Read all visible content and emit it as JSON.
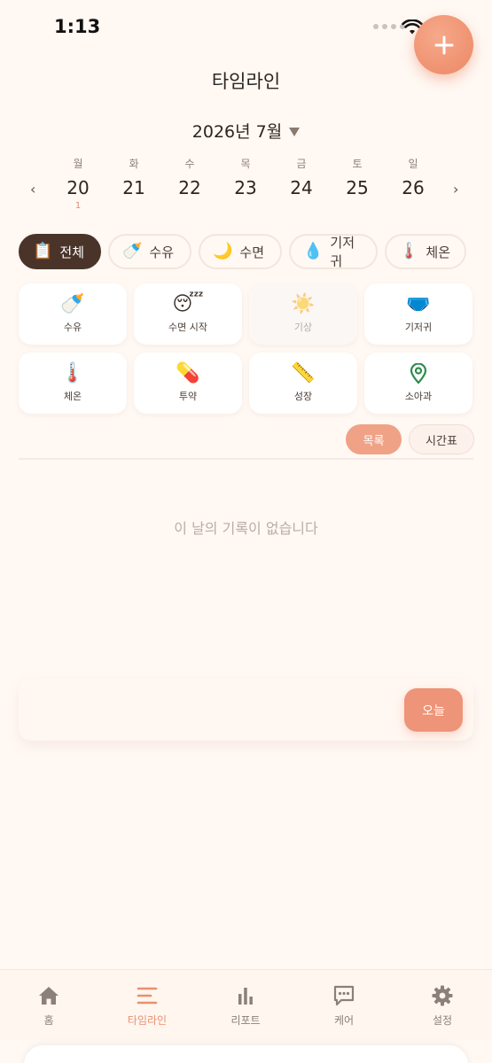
{
  "status_bar": {
    "time": "1:13"
  },
  "header": {
    "title": "타임라인",
    "add_button_icon": "plus-icon"
  },
  "calendar": {
    "month_label": "2026년 7월",
    "days": [
      {
        "name": "월",
        "num": "20",
        "count": "1"
      },
      {
        "name": "화",
        "num": "21",
        "count": ""
      },
      {
        "name": "수",
        "num": "22",
        "count": ""
      },
      {
        "name": "목",
        "num": "23",
        "count": ""
      },
      {
        "name": "금",
        "num": "24",
        "count": ""
      },
      {
        "name": "토",
        "num": "25",
        "count": ""
      },
      {
        "name": "일",
        "num": "26",
        "count": ""
      }
    ]
  },
  "filters": [
    {
      "label": "전체",
      "icon": "📋",
      "active": true
    },
    {
      "label": "수유",
      "icon": "🍼"
    },
    {
      "label": "수면",
      "icon": "🌙"
    },
    {
      "label": "기저귀",
      "icon": "💧"
    },
    {
      "label": "체온",
      "icon": "🌡️"
    }
  ],
  "quick_actions": [
    {
      "label": "수유",
      "icon": "🍼"
    },
    {
      "label": "수면 시작",
      "icon": "😴"
    },
    {
      "label": "기상",
      "icon": "☀️",
      "dim": true
    },
    {
      "label": "기저귀",
      "icon": "🩲"
    },
    {
      "label": "체온",
      "icon": "🌡️"
    },
    {
      "label": "투약",
      "icon": "💊"
    },
    {
      "label": "성장",
      "icon": "📏"
    },
    {
      "label": "소아과",
      "icon": "📍"
    }
  ],
  "view_toggle": {
    "list": "목록",
    "timetable": "시간표"
  },
  "empty_state": "이 날의 기록이 없습니다",
  "today_button": "오늘",
  "tabs": [
    {
      "label": "홈",
      "icon": "home-icon"
    },
    {
      "label": "타임라인",
      "icon": "timeline-icon",
      "active": true
    },
    {
      "label": "리포트",
      "icon": "report-icon"
    },
    {
      "label": "케어",
      "icon": "chat-icon"
    },
    {
      "label": "설정",
      "icon": "gear-icon"
    }
  ],
  "colors": {
    "accent": "#EE9478",
    "dark_chip": "#4A342A",
    "background": "#FFF8F3",
    "active_tab": "#E8906F"
  }
}
